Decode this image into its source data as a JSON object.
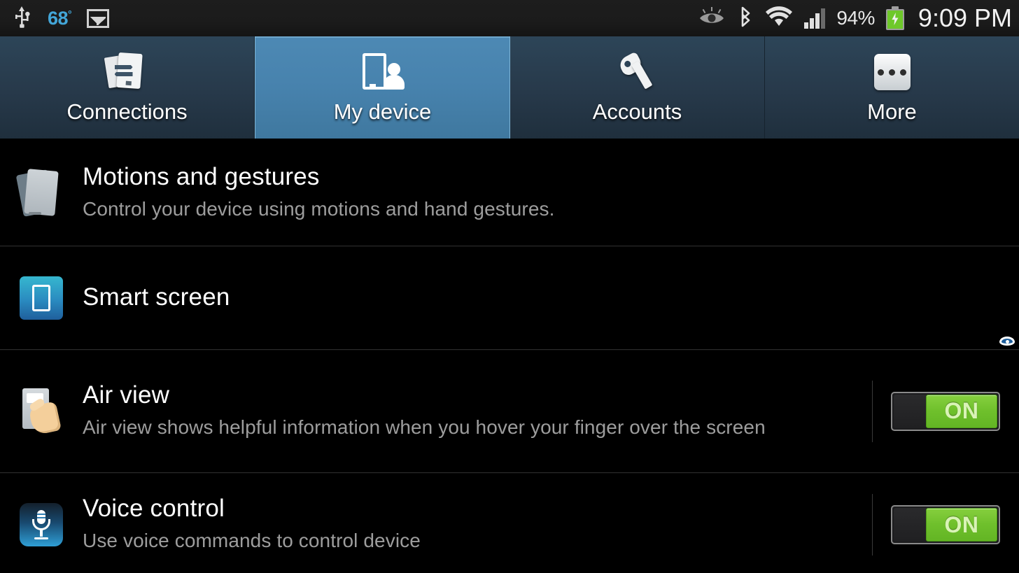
{
  "status_bar": {
    "usb_icon": "usb-icon",
    "temperature": "68",
    "temperature_unit": "°",
    "image_icon": "image-icon",
    "smart_stay_icon": "smart-stay-eye-icon",
    "bluetooth_icon": "bluetooth-icon",
    "wifi_icon": "wifi-icon",
    "signal_icon": "cellular-signal-icon",
    "battery_percent": "94%",
    "battery_icon": "battery-charging-icon",
    "clock": "9:09 PM"
  },
  "tabs": [
    {
      "label": "Connections",
      "icon": "connections-icon",
      "active": false
    },
    {
      "label": "My device",
      "icon": "my-device-icon",
      "active": true
    },
    {
      "label": "Accounts",
      "icon": "accounts-key-icon",
      "active": false
    },
    {
      "label": "More",
      "icon": "more-dots-icon",
      "active": false
    }
  ],
  "settings": [
    {
      "title": "Motions and gestures",
      "description": "Control your device using motions and hand gestures.",
      "icon": "motions-and-gestures-icon",
      "toggle": null
    },
    {
      "title": "Smart screen",
      "description": "",
      "icon": "smart-screen-icon",
      "toggle": null
    },
    {
      "title": "Air view",
      "description": "Air view shows helpful information when you hover your finger over the screen",
      "icon": "air-view-icon",
      "toggle": "ON"
    },
    {
      "title": "Voice control",
      "description": "Use voice commands to control device",
      "icon": "voice-control-icon",
      "toggle": "ON"
    }
  ],
  "colors": {
    "background": "#000000",
    "tabbar": "#27394a",
    "tab_active": "#4782ad",
    "toggle_on": "#6fc02c",
    "accent_blue": "#43a6d8",
    "title_text": "#ffffff",
    "desc_text": "#9d9d9d"
  }
}
